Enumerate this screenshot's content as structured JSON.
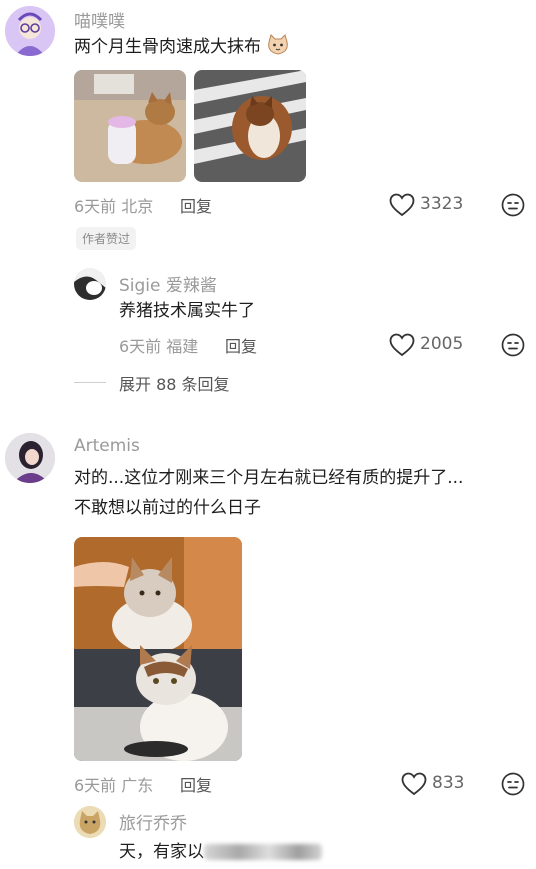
{
  "comments": [
    {
      "username": "喵噗噗",
      "text": "两个月生骨肉速成大抹布",
      "meta": "6天前 北京",
      "reply_label": "回复",
      "likes": "3323",
      "badge": "作者赞过",
      "replies": [
        {
          "username": "Sigie 爱辣酱",
          "text": "养猪技术属实牛了",
          "meta": "6天前 福建",
          "reply_label": "回复",
          "likes": "2005"
        }
      ],
      "expand_label": "展开 88 条回复"
    },
    {
      "username": "Artemis",
      "text_line1": "对的...这位才刚来三个月左右就已经有质的提升了...",
      "text_line2": "不敢想以前过的什么日子",
      "meta": "6天前 广东",
      "reply_label": "回复",
      "likes": "833",
      "replies": [
        {
          "username": "旅行乔乔",
          "text": "天，有家以"
        }
      ]
    }
  ],
  "colors": {
    "muted": "#9a9a9a",
    "text": "#1e1e1e",
    "badge_bg": "#f2f2f2"
  }
}
